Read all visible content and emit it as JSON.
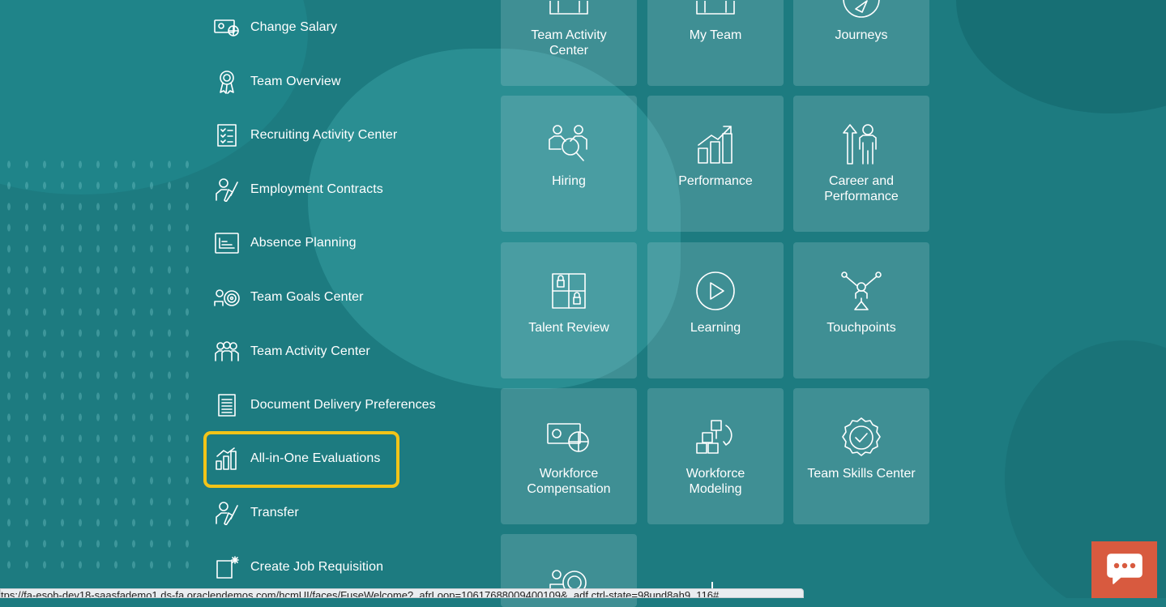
{
  "quick_actions": [
    {
      "label": "Change Salary",
      "icon": "salary-icon"
    },
    {
      "label": "Team Overview",
      "icon": "award-icon"
    },
    {
      "label": "Recruiting Activity Center",
      "icon": "checklist-icon"
    },
    {
      "label": "Employment Contracts",
      "icon": "contract-sign-icon"
    },
    {
      "label": "Absence Planning",
      "icon": "calendar-plan-icon"
    },
    {
      "label": "Team Goals Center",
      "icon": "target-icon"
    },
    {
      "label": "Team Activity Center",
      "icon": "team-icon"
    },
    {
      "label": "Document Delivery Preferences",
      "icon": "document-icon"
    },
    {
      "label": "All-in-One Evaluations",
      "icon": "bar-chart-icon"
    },
    {
      "label": "Transfer",
      "icon": "transfer-icon"
    },
    {
      "label": "Create Job Requisition",
      "icon": "new-requisition-icon"
    }
  ],
  "tiles": [
    {
      "label": "Team Activity Center",
      "icon": "team-activity-icon"
    },
    {
      "label": "My Team",
      "icon": "my-team-icon"
    },
    {
      "label": "Journeys",
      "icon": "compass-icon"
    },
    {
      "label": "Hiring",
      "icon": "hiring-icon"
    },
    {
      "label": "Performance",
      "icon": "performance-chart-icon"
    },
    {
      "label": "Career and Performance",
      "icon": "career-icon"
    },
    {
      "label": "Talent Review",
      "icon": "talent-review-icon"
    },
    {
      "label": "Learning",
      "icon": "play-icon"
    },
    {
      "label": "Touchpoints",
      "icon": "touchpoints-icon"
    },
    {
      "label": "Workforce Compensation",
      "icon": "compensation-icon"
    },
    {
      "label": "Workforce Modeling",
      "icon": "modeling-icon"
    },
    {
      "label": "Team Skills Center",
      "icon": "skills-badge-icon"
    },
    {
      "label": "",
      "icon": "goals-icon"
    }
  ],
  "status_url": "tps://fa-esob-dev18-saasfademo1.ds-fa.oraclendemos.com/hcmUI/faces/FuseWelcome?_afrLoop=10617688009400109&_adf.ctrl-state=98und8ah9_116#",
  "colors": {
    "background": "#1d7b80",
    "highlight": "#f2c418",
    "chat": "#d85a3f"
  }
}
